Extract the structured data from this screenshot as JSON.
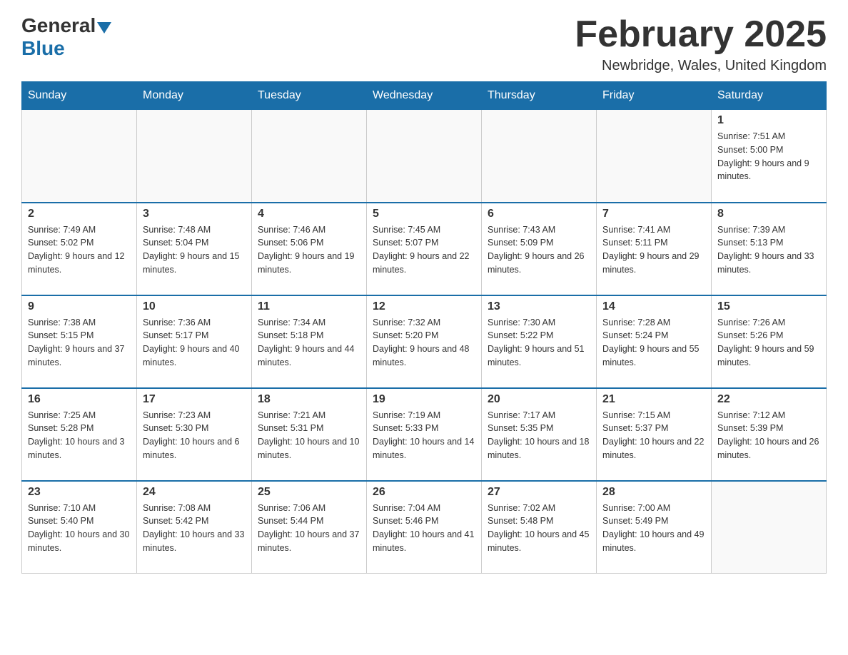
{
  "logo": {
    "general": "General",
    "blue": "Blue"
  },
  "title": {
    "month_year": "February 2025",
    "location": "Newbridge, Wales, United Kingdom"
  },
  "weekdays": [
    "Sunday",
    "Monday",
    "Tuesday",
    "Wednesday",
    "Thursday",
    "Friday",
    "Saturday"
  ],
  "weeks": [
    [
      {
        "day": "",
        "info": ""
      },
      {
        "day": "",
        "info": ""
      },
      {
        "day": "",
        "info": ""
      },
      {
        "day": "",
        "info": ""
      },
      {
        "day": "",
        "info": ""
      },
      {
        "day": "",
        "info": ""
      },
      {
        "day": "1",
        "info": "Sunrise: 7:51 AM\nSunset: 5:00 PM\nDaylight: 9 hours and 9 minutes."
      }
    ],
    [
      {
        "day": "2",
        "info": "Sunrise: 7:49 AM\nSunset: 5:02 PM\nDaylight: 9 hours and 12 minutes."
      },
      {
        "day": "3",
        "info": "Sunrise: 7:48 AM\nSunset: 5:04 PM\nDaylight: 9 hours and 15 minutes."
      },
      {
        "day": "4",
        "info": "Sunrise: 7:46 AM\nSunset: 5:06 PM\nDaylight: 9 hours and 19 minutes."
      },
      {
        "day": "5",
        "info": "Sunrise: 7:45 AM\nSunset: 5:07 PM\nDaylight: 9 hours and 22 minutes."
      },
      {
        "day": "6",
        "info": "Sunrise: 7:43 AM\nSunset: 5:09 PM\nDaylight: 9 hours and 26 minutes."
      },
      {
        "day": "7",
        "info": "Sunrise: 7:41 AM\nSunset: 5:11 PM\nDaylight: 9 hours and 29 minutes."
      },
      {
        "day": "8",
        "info": "Sunrise: 7:39 AM\nSunset: 5:13 PM\nDaylight: 9 hours and 33 minutes."
      }
    ],
    [
      {
        "day": "9",
        "info": "Sunrise: 7:38 AM\nSunset: 5:15 PM\nDaylight: 9 hours and 37 minutes."
      },
      {
        "day": "10",
        "info": "Sunrise: 7:36 AM\nSunset: 5:17 PM\nDaylight: 9 hours and 40 minutes."
      },
      {
        "day": "11",
        "info": "Sunrise: 7:34 AM\nSunset: 5:18 PM\nDaylight: 9 hours and 44 minutes."
      },
      {
        "day": "12",
        "info": "Sunrise: 7:32 AM\nSunset: 5:20 PM\nDaylight: 9 hours and 48 minutes."
      },
      {
        "day": "13",
        "info": "Sunrise: 7:30 AM\nSunset: 5:22 PM\nDaylight: 9 hours and 51 minutes."
      },
      {
        "day": "14",
        "info": "Sunrise: 7:28 AM\nSunset: 5:24 PM\nDaylight: 9 hours and 55 minutes."
      },
      {
        "day": "15",
        "info": "Sunrise: 7:26 AM\nSunset: 5:26 PM\nDaylight: 9 hours and 59 minutes."
      }
    ],
    [
      {
        "day": "16",
        "info": "Sunrise: 7:25 AM\nSunset: 5:28 PM\nDaylight: 10 hours and 3 minutes."
      },
      {
        "day": "17",
        "info": "Sunrise: 7:23 AM\nSunset: 5:30 PM\nDaylight: 10 hours and 6 minutes."
      },
      {
        "day": "18",
        "info": "Sunrise: 7:21 AM\nSunset: 5:31 PM\nDaylight: 10 hours and 10 minutes."
      },
      {
        "day": "19",
        "info": "Sunrise: 7:19 AM\nSunset: 5:33 PM\nDaylight: 10 hours and 14 minutes."
      },
      {
        "day": "20",
        "info": "Sunrise: 7:17 AM\nSunset: 5:35 PM\nDaylight: 10 hours and 18 minutes."
      },
      {
        "day": "21",
        "info": "Sunrise: 7:15 AM\nSunset: 5:37 PM\nDaylight: 10 hours and 22 minutes."
      },
      {
        "day": "22",
        "info": "Sunrise: 7:12 AM\nSunset: 5:39 PM\nDaylight: 10 hours and 26 minutes."
      }
    ],
    [
      {
        "day": "23",
        "info": "Sunrise: 7:10 AM\nSunset: 5:40 PM\nDaylight: 10 hours and 30 minutes."
      },
      {
        "day": "24",
        "info": "Sunrise: 7:08 AM\nSunset: 5:42 PM\nDaylight: 10 hours and 33 minutes."
      },
      {
        "day": "25",
        "info": "Sunrise: 7:06 AM\nSunset: 5:44 PM\nDaylight: 10 hours and 37 minutes."
      },
      {
        "day": "26",
        "info": "Sunrise: 7:04 AM\nSunset: 5:46 PM\nDaylight: 10 hours and 41 minutes."
      },
      {
        "day": "27",
        "info": "Sunrise: 7:02 AM\nSunset: 5:48 PM\nDaylight: 10 hours and 45 minutes."
      },
      {
        "day": "28",
        "info": "Sunrise: 7:00 AM\nSunset: 5:49 PM\nDaylight: 10 hours and 49 minutes."
      },
      {
        "day": "",
        "info": ""
      }
    ]
  ]
}
